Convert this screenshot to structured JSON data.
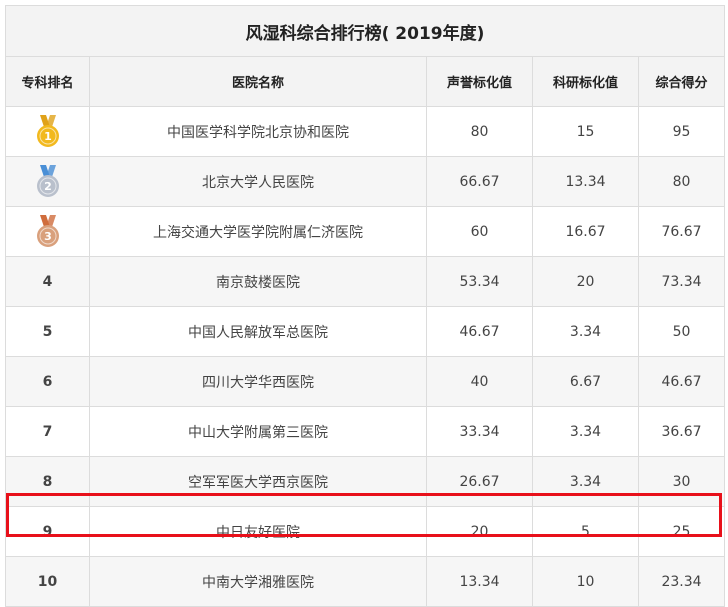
{
  "title": "风湿科综合排行榜( 2019年度)",
  "columns": [
    "专科排名",
    "医院名称",
    "声誉标化值",
    "科研标化值",
    "综合得分"
  ],
  "rows": [
    {
      "rank": "1",
      "medal": "gold",
      "hospital": "中国医学科学院北京协和医院",
      "reputation": "80",
      "research": "15",
      "total": "95"
    },
    {
      "rank": "2",
      "medal": "silver",
      "hospital": "北京大学人民医院",
      "reputation": "66.67",
      "research": "13.34",
      "total": "80"
    },
    {
      "rank": "3",
      "medal": "bronze",
      "hospital": "上海交通大学医学院附属仁济医院",
      "reputation": "60",
      "research": "16.67",
      "total": "76.67"
    },
    {
      "rank": "4",
      "hospital": "南京鼓楼医院",
      "reputation": "53.34",
      "research": "20",
      "total": "73.34"
    },
    {
      "rank": "5",
      "hospital": "中国人民解放军总医院",
      "reputation": "46.67",
      "research": "3.34",
      "total": "50"
    },
    {
      "rank": "6",
      "hospital": "四川大学华西医院",
      "reputation": "40",
      "research": "6.67",
      "total": "46.67"
    },
    {
      "rank": "7",
      "hospital": "中山大学附属第三医院",
      "reputation": "33.34",
      "research": "3.34",
      "total": "36.67"
    },
    {
      "rank": "8",
      "hospital": "空军军医大学西京医院",
      "reputation": "26.67",
      "research": "3.34",
      "total": "30"
    },
    {
      "rank": "9",
      "hospital": "中日友好医院",
      "reputation": "20",
      "research": "5",
      "total": "25"
    },
    {
      "rank": "10",
      "hospital": "中南大学湘雅医院",
      "reputation": "13.34",
      "research": "10",
      "total": "23.34"
    }
  ],
  "medal_colors": {
    "gold": "#f2b91e",
    "silver": "#b9c0cc",
    "bronze": "#d9a07c",
    "ribbon_gold": "#e0a21a",
    "ribbon_silver": "#4a8fd6",
    "ribbon_bronze": "#d06d3d"
  },
  "highlight_color": "#e8101a",
  "link_color": "#2a70b8"
}
